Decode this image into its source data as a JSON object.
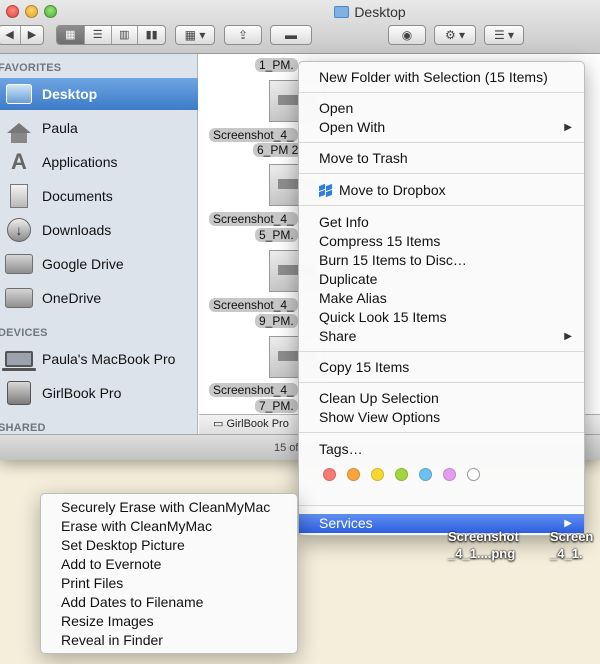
{
  "window": {
    "title": "Desktop",
    "status": "15 of"
  },
  "sidebar": {
    "favorites_header": "FAVORITES",
    "devices_header": "DEVICES",
    "shared_header": "SHARED",
    "favorites": [
      {
        "label": "Desktop",
        "icon": "desktop-icon"
      },
      {
        "label": "Paula",
        "icon": "home-icon"
      },
      {
        "label": "Applications",
        "icon": "applications-icon"
      },
      {
        "label": "Documents",
        "icon": "documents-icon"
      },
      {
        "label": "Downloads",
        "icon": "downloads-icon"
      },
      {
        "label": "Google Drive",
        "icon": "folder-icon"
      },
      {
        "label": "OneDrive",
        "icon": "folder-icon"
      }
    ],
    "devices": [
      {
        "label": "Paula's MacBook Pro",
        "icon": "laptop-icon"
      },
      {
        "label": "GirlBook Pro",
        "icon": "disk-icon"
      }
    ]
  },
  "files": [
    {
      "line1": "1_PM.",
      "line2": ""
    },
    {
      "line1": "Screenshot_4_",
      "line2": "6_PM 2"
    },
    {
      "line1": "Screenshot_4_",
      "line2": "5_PM."
    },
    {
      "line1": "Screenshot_4_",
      "line2": "9_PM."
    },
    {
      "line1": "Screenshot_4_",
      "line2": "7_PM."
    }
  ],
  "pathbar": "GirlBook Pro",
  "context_menu": {
    "new_folder": "New Folder with Selection (15 Items)",
    "open": "Open",
    "open_with": "Open With",
    "move_to_trash": "Move to Trash",
    "move_to_dropbox": "Move to Dropbox",
    "get_info": "Get Info",
    "compress": "Compress 15 Items",
    "burn": "Burn 15 Items to Disc…",
    "duplicate": "Duplicate",
    "make_alias": "Make Alias",
    "quick_look": "Quick Look 15 Items",
    "share": "Share",
    "copy": "Copy 15 Items",
    "clean_up": "Clean Up Selection",
    "show_view_options": "Show View Options",
    "tags": "Tags…",
    "services": "Services",
    "tag_colors": [
      "#f77b74",
      "#f9a53c",
      "#f7d82f",
      "#a2d63d",
      "#6ec0f0",
      "#e59df0",
      "#ffffff"
    ]
  },
  "services_menu": [
    "Securely Erase with CleanMyMac",
    "Erase with CleanMyMac",
    "Set Desktop Picture",
    "Add to Evernote",
    "Print Files",
    "Add Dates to Filename",
    "Resize Images",
    "Reveal in Finder"
  ],
  "desktop_icons": [
    {
      "line1": "Screenshot",
      "line2": "_4_1....png"
    },
    {
      "line1": "Screen",
      "line2": "_4_1."
    }
  ]
}
